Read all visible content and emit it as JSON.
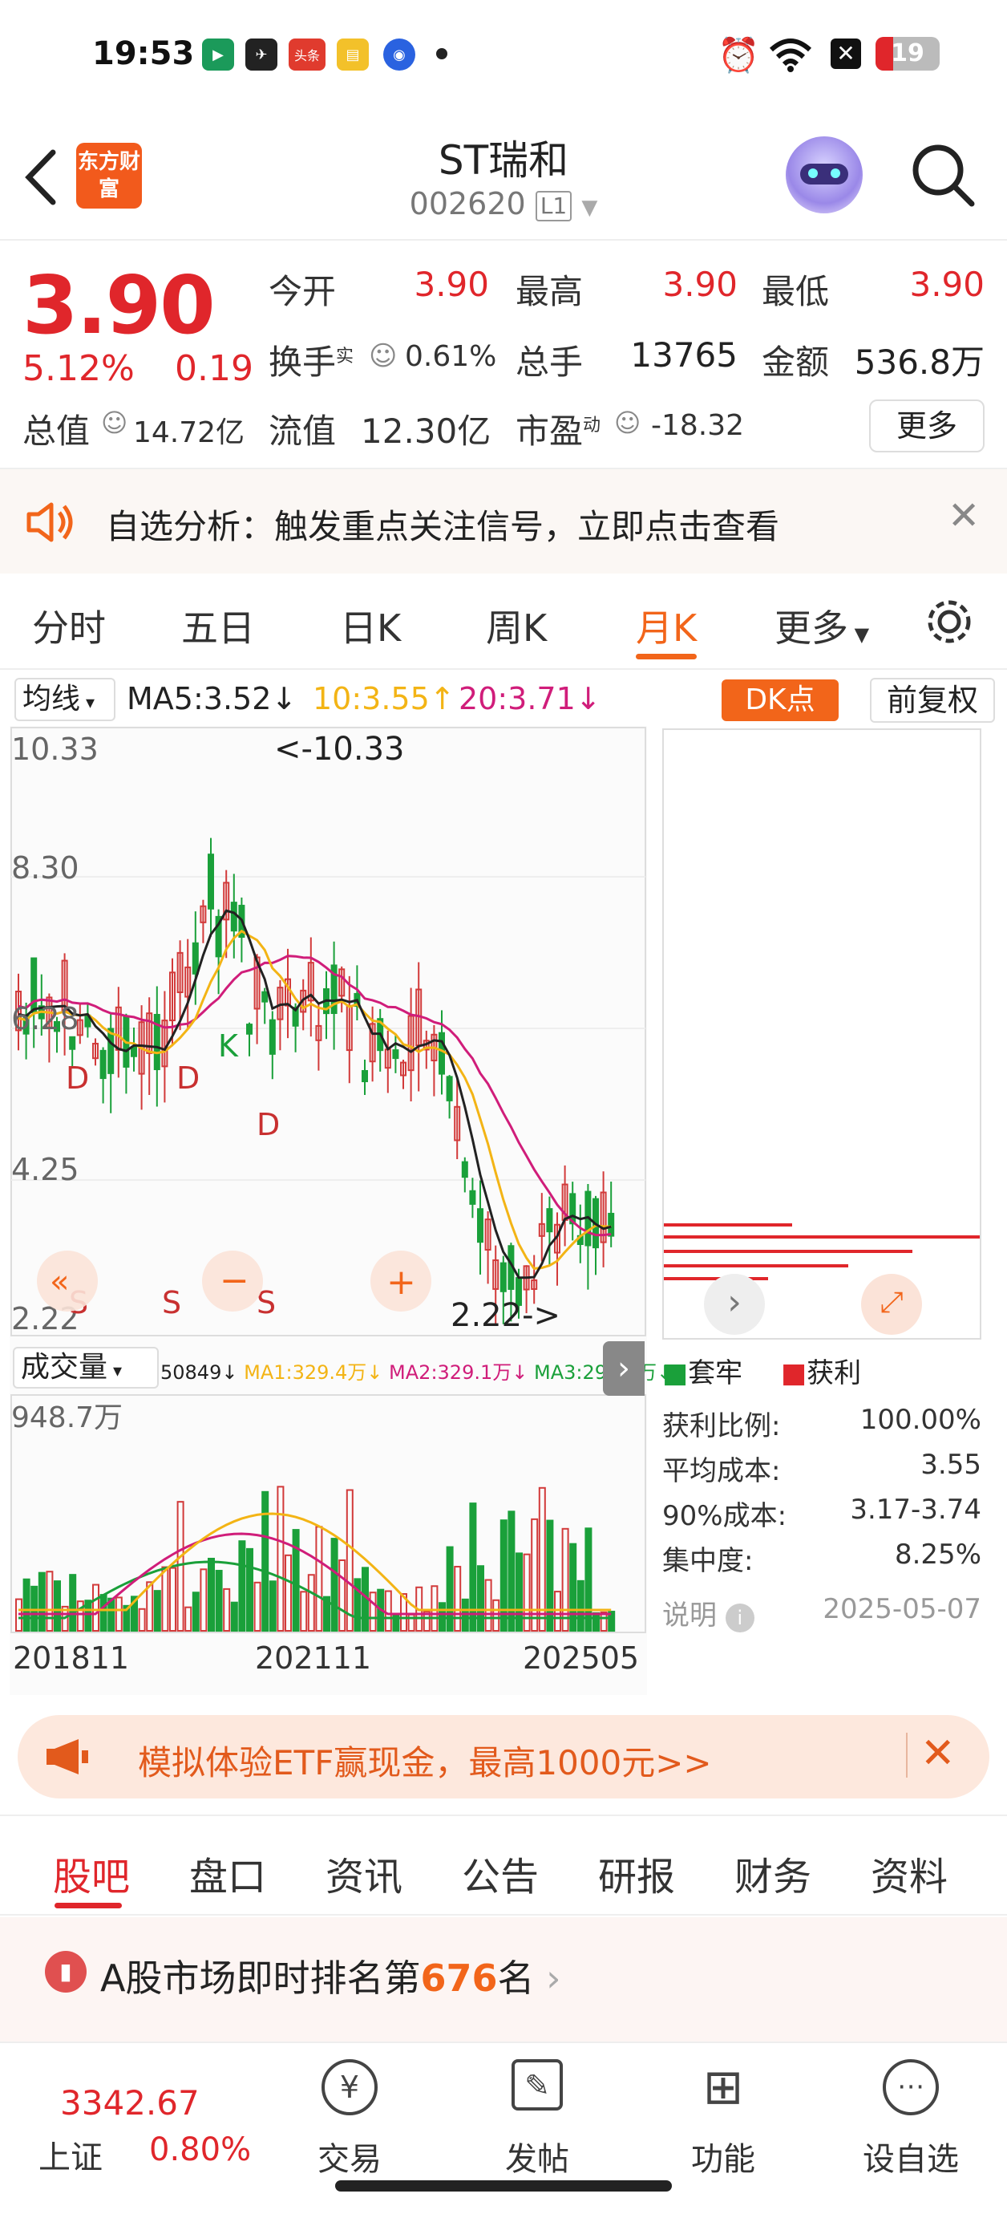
{
  "status_bar": {
    "time": "19:53",
    "battery": "19",
    "app_icon_labels": [
      "头条"
    ]
  },
  "header": {
    "title": "ST瑞和",
    "code": "002620",
    "level": "L1",
    "logo_text": "东方财富"
  },
  "quote": {
    "price": "3.90",
    "change_pct": "5.12%",
    "change": "0.19",
    "open_label": "今开",
    "open": "3.90",
    "high_label": "最高",
    "high": "3.90",
    "low_label": "最低",
    "low": "3.90",
    "turnover_label": "换手",
    "turnover_sup": "实",
    "turnover": "0.61%",
    "volume_label": "总手",
    "volume": "13765",
    "amount_label": "金额",
    "amount": "536.8万",
    "mktcap_label": "总值",
    "mktcap": "14.72亿",
    "float_label": "流值",
    "float": "12.30亿",
    "pe_label": "市盈",
    "pe_sup": "动",
    "pe": "-18.32",
    "more": "更多"
  },
  "banner": {
    "text": "自选分析：触发重点关注信号，立即点击查看"
  },
  "kline_tabs": {
    "items": [
      "分时",
      "五日",
      "日K",
      "周K",
      "月K",
      "更多"
    ],
    "active": "月K"
  },
  "ma_row": {
    "selector": "均线",
    "ma5": "MA5:3.52↓",
    "ma10": "10:3.55↑",
    "ma20": "20:3.71↓",
    "dk": "DK点",
    "adjust": "前复权"
  },
  "kchart": {
    "ylabels": [
      "10.33",
      "8.30",
      "6.28",
      "4.25",
      "2.22"
    ],
    "max_label": "<-10.33",
    "min_label": "2.22->",
    "signals": [
      "D",
      "D",
      "K",
      "D",
      "S",
      "S",
      "S"
    ]
  },
  "volume": {
    "selector": "成交量",
    "vol": "50849↓",
    "ma1": "MA1:329.4万↓",
    "ma2": "MA2:329.1万↓",
    "ma3": "MA3:292.2万↓",
    "max": "948.7万"
  },
  "xaxis": {
    "labels": [
      "201811",
      "202111",
      "202505"
    ]
  },
  "chip": {
    "legend_trapped": "套牢",
    "legend_profit": "获利",
    "rows": [
      {
        "label": "获利比例:",
        "value": "100.00%"
      },
      {
        "label": "平均成本:",
        "value": "3.55"
      },
      {
        "label": "90%成本:",
        "value": "3.17-3.74"
      },
      {
        "label": "集中度:",
        "value": "8.25%"
      }
    ],
    "note": "说明",
    "date": "2025-05-07"
  },
  "etf": {
    "text": "模拟体验ETF赢现金，最高1000元>>"
  },
  "bottom_tabs": {
    "items": [
      "股吧",
      "盘口",
      "资讯",
      "公告",
      "研报",
      "财务",
      "资料"
    ],
    "active": "股吧"
  },
  "rank": {
    "prefix": "A股市场即时排名第",
    "num": "676",
    "suffix": "名"
  },
  "nav": {
    "index_value": "3342.67",
    "index_name": "上证",
    "index_pct": "0.80%",
    "items": [
      "交易",
      "发帖",
      "功能",
      "设自选"
    ]
  },
  "colors": {
    "up": "#e0262b",
    "down": "#1aa03a",
    "accent": "#f2651a",
    "ma5": "#222222",
    "ma10": "#f3b415",
    "ma20": "#d01d7a"
  }
}
